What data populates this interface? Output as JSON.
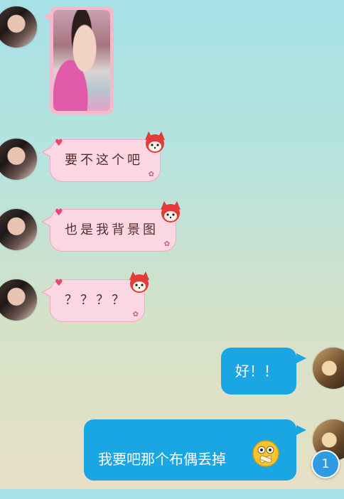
{
  "messages": {
    "m2": "要不这个吧",
    "m3": "也是我背景图",
    "m4": "？？？？",
    "m5": "好！！",
    "m6": "我要吧那个布偶丢掉"
  },
  "badge": {
    "count": "1"
  },
  "colors": {
    "pink_bubble": "#fbd7e4",
    "blue_bubble": "#1aa6e3",
    "heart": "#e8456f"
  }
}
